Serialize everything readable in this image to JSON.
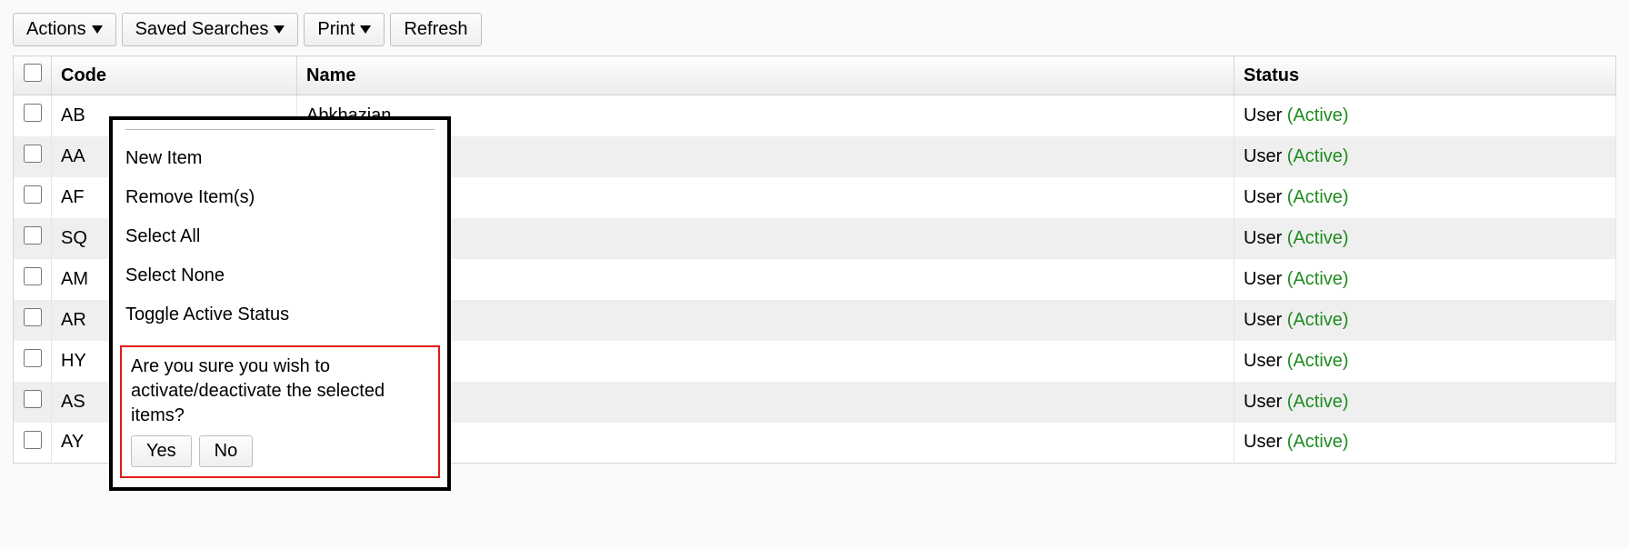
{
  "toolbar": {
    "actions": "Actions",
    "saved_searches": "Saved Searches",
    "print": "Print",
    "refresh": "Refresh"
  },
  "columns": {
    "code": "Code",
    "name": "Name",
    "status": "Status"
  },
  "status_label_prefix": "User ",
  "status_active": "(Active)",
  "rows": [
    {
      "code": "AB",
      "name": "Abkhazian"
    },
    {
      "code": "AA",
      "name": ""
    },
    {
      "code": "AF",
      "name": ""
    },
    {
      "code": "SQ",
      "name": ""
    },
    {
      "code": "AM",
      "name": ""
    },
    {
      "code": "AR",
      "name": ""
    },
    {
      "code": "HY",
      "name": ""
    },
    {
      "code": "AS",
      "name": ""
    },
    {
      "code": "AY",
      "name": ""
    }
  ],
  "actions_menu": {
    "new_item": "New Item",
    "remove_items": "Remove Item(s)",
    "select_all": "Select All",
    "select_none": "Select None",
    "toggle_active": "Toggle Active Status"
  },
  "confirm": {
    "message": "Are you sure you wish to activate/deactivate the selected items?",
    "yes": "Yes",
    "no": "No"
  }
}
